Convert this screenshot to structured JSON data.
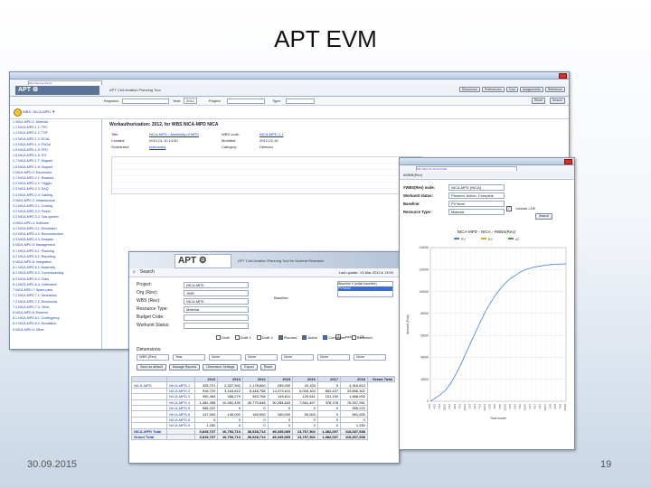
{
  "slide": {
    "title": "APT EVM",
    "date": "30.09.2015",
    "page": "19"
  },
  "colors": {
    "chrome": "#b8cbe3",
    "banner": "#2f4360",
    "link": "#1a3fa3",
    "curve": "#4a7fd0",
    "background": "#dce5f0"
  },
  "w1": {
    "url": "http://apt.csc.fi/evm",
    "banner": "APT Civil Aviation Planning Tool",
    "menu": [
      "Resources",
      "Preferences",
      "Cost",
      "Assignments",
      "Reference"
    ],
    "filter": {
      "keyword_label": "Keyword:",
      "keyword": "",
      "year_label": "Year:",
      "year": "2012",
      "project_label": "Project:",
      "type_label": "Type:"
    },
    "nav_buttons": [
      "Reset",
      "Search"
    ],
    "tabs_label": "WBS: NICA-MPD ▼",
    "section_title": "Workauthorization: 2012, for WBS NICA-MPD NICA",
    "fields": [
      {
        "label": "Title:",
        "value": "NICA-MPD - Assembly of MPD"
      },
      {
        "label": "WBS code:",
        "value": "NICA-MPD.1.1"
      },
      {
        "label": "Created:",
        "value": "2012-01-10 14:30"
      },
      {
        "label": "Modified:",
        "value": "2012-02-15"
      },
      {
        "label": "Scheduled:",
        "value": "scheduled"
      },
      {
        "label": "Category:",
        "value": "Detector"
      }
    ],
    "tree": [
      "1 NICA-MPD.1: Detector",
      "1.1 NICA-MPD.1.1: TPC",
      "1.2 NICA-MPD.1.2: TOF",
      "1.3 NICA-MPD.1.3: ECAL",
      "1.4 NICA-MPD.1.4: FHCal",
      "1.5 NICA-MPD.1.5: FFD",
      "1.6 NICA-MPD.1.6: ITS",
      "1.7 NICA-MPD.1.7: Magnet",
      "1.8 NICA-MPD.1.8: Support",
      "2 NICA-MPD.2: Electronics",
      "2.1 NICA-MPD.2.1: Readout",
      "2.2 NICA-MPD.2.2: Trigger",
      "2.3 NICA-MPD.2.3: DAQ",
      "2.4 NICA-MPD.2.4: Cabling",
      "3 NICA-MPD.3: Infrastructure",
      "3.1 NICA-MPD.3.1: Cooling",
      "3.2 NICA-MPD.3.2: Power",
      "3.3 NICA-MPD.3.3: Gas system",
      "4 NICA-MPD.4: Software",
      "4.1 NICA-MPD.4.1: Simulation",
      "4.2 NICA-MPD.4.2: Reconstruction",
      "4.3 NICA-MPD.4.3: Analysis",
      "5 NICA-MPD.5: Management",
      "5.1 NICA-MPD.5.1: Planning",
      "5.2 NICA-MPD.5.2: Reporting",
      "6 NICA-MPD.6: Integration",
      "6.1 NICA-MPD.6.1: Assembly",
      "6.2 NICA-MPD.6.2: Commissioning",
      "6.3 NICA-MPD.6.3: Tests",
      "6.4 NICA-MPD.6.4: Calibration",
      "7 NICA-MPD.7: Spare parts",
      "7.1 NICA-MPD.7.1: Mechanics",
      "7.2 NICA-MPD.7.2: Electronics",
      "7.3 NICA-MPD.7.3: Other",
      "8 NICA-MPD.8: Reserve",
      "8.1 NICA-MPD.8.1: Contingency",
      "8.2 NICA-MPD.8.2: Escalation",
      "9 NICA-MPD.9: Other"
    ]
  },
  "w2": {
    "title": "#WBS(Rev)",
    "url": "http://apt.csc.fi/evm/chart",
    "form": [
      {
        "label": "#WBS(Rev) node:",
        "value": "NICA-MPD (NICA)"
      },
      {
        "label": "Workunit status:",
        "value": "Planned, Active, Complete"
      },
      {
        "label": "Baseline:",
        "value": "PV*level"
      },
      {
        "label": "Resource Type:",
        "value": "Material"
      }
    ],
    "include_lde": "Include LDE",
    "search": "Search",
    "chart_title": "NICA-MPD - NICA - #WBS(Rev)"
  },
  "w3": {
    "banner": "APT Civil Aviation Planning Tool for Nuclear Research",
    "search_label": "Search",
    "login": "Last update: 13-Mar-2012 ▸ 13:00",
    "form": [
      {
        "label": "Project:",
        "value": "NICA-MPD"
      },
      {
        "label": "Org (Rev):",
        "value": "JINR"
      },
      {
        "label": "WBS (Rev):",
        "value": "NICA-MPD"
      },
      {
        "label": "Resource Type:",
        "value": "Material"
      },
      {
        "label": "Budget Code:",
        "value": ""
      },
      {
        "label": "Workunit Status:",
        "value": ""
      }
    ],
    "baseline_label": "Baseline:",
    "baseline_options": [
      "Baseline 0 (initial baseline)",
      "PV*level"
    ],
    "include_lde": "Include LDE",
    "statuses": [
      "Draft",
      "Draft 1",
      "Draft 2",
      "Planned",
      "Active",
      "Completed",
      "Canceled"
    ],
    "dimensions_label": "Dimensions:",
    "dimensions": [
      "WBS (Rev)",
      "Year",
      "None",
      "None",
      "None",
      "None",
      "None"
    ],
    "buttons": [
      "Save as default",
      "Manage Reports",
      "Dimension Settings",
      "Export",
      "Reset"
    ],
    "table_headers": [
      "",
      "",
      "2012",
      "2013",
      "2014",
      "2015",
      "2016",
      "2017",
      "2018",
      "Grand Total"
    ],
    "table_rows": [
      [
        "NICA-MPD",
        "NICA-MPD.1",
        "325,721",
        "2,537,392",
        "1,178,600",
        "255,000",
        "20,100",
        "0",
        "4,316,813"
      ],
      [
        "",
        "NICA-MPD.2",
        "916,720",
        "3,164,612",
        "8,446,758",
        "14,479,611",
        "6,006,164",
        "852,437",
        "33,866,302"
      ],
      [
        "",
        "NICA-MPD.3",
        "392,469",
        "486,279",
        "363,708",
        "145,811",
        "129,541",
        "151,192",
        "1,668,000"
      ],
      [
        "",
        "NICA-MPD.4",
        "1,481,355",
        "10,461,430",
        "26,770,648",
        "30,284,643",
        "7,561,497",
        "378,378",
        "76,937,951"
      ],
      [
        "",
        "NICA-MPD.5",
        "555,222",
        "0",
        "0",
        "0",
        "0",
        "0",
        "555,222"
      ],
      [
        "",
        "NICA-MPD.6",
        "147,000",
        "145,000",
        "169,000",
        "180,000",
        "50,000",
        "0",
        "691,000"
      ],
      [
        "",
        "NICA-MPD.8",
        "0",
        "0",
        "0",
        "0",
        "0",
        "0",
        "0"
      ],
      [
        "",
        "NICA-MPD.9",
        "1,250",
        "0",
        "0",
        "0",
        "0",
        "0",
        "1,250"
      ]
    ],
    "total_row": [
      "NICA-MPD Total",
      "",
      "3,819,737",
      "16,794,713",
      "36,928,714",
      "45,345,065",
      "13,767,302",
      "1,382,007",
      "118,037,538"
    ],
    "grand_total_row": [
      "Grand Total",
      "",
      "3,819,737",
      "16,794,713",
      "36,928,714",
      "45,345,065",
      "13,767,302",
      "1,382,007",
      "118,037,538"
    ]
  },
  "chart_data": {
    "type": "line",
    "title": "NICA-MPD - NICA - #WBS(Rev)",
    "legend": [
      "PV",
      "EV",
      "AC"
    ],
    "ylabel": "Amount (Rub)",
    "xlabel": "Time month",
    "ylim": [
      0,
      140000
    ],
    "yticks": [
      "0",
      "20000",
      "40000",
      "60000",
      "80000",
      "100000",
      "120000",
      "140000"
    ],
    "x": [
      "1/12",
      "4/12",
      "7/12",
      "10/12",
      "1/13",
      "4/13",
      "7/13",
      "10/13",
      "1/14",
      "4/14",
      "7/14",
      "10/14",
      "1/15",
      "4/15",
      "7/15",
      "10/15",
      "1/16",
      "4/16",
      "7/16",
      "10/16",
      "1/17",
      "4/17",
      "7/17",
      "10/17",
      "1/18",
      "4/18",
      "7/18",
      "10/18"
    ],
    "series": [
      {
        "name": "PV",
        "values": [
          0,
          3000,
          6000,
          10000,
          16000,
          24000,
          33000,
          43000,
          53000,
          63000,
          73000,
          82000,
          90000,
          97000,
          103000,
          108000,
          112000,
          115000,
          118000,
          120000,
          121500,
          122500,
          123300,
          124000,
          124500,
          124800,
          125000,
          125200
        ]
      }
    ]
  }
}
